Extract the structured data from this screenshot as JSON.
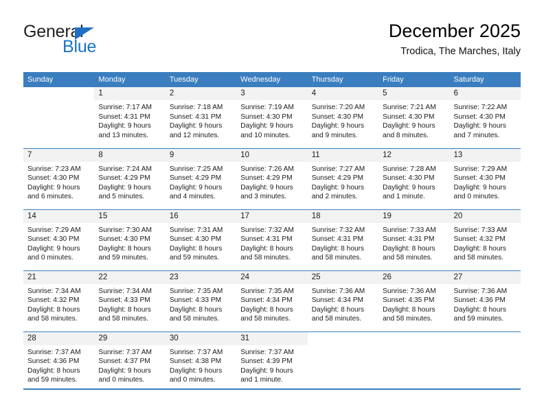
{
  "brand": {
    "word_general": "General",
    "word_blue": "Blue",
    "triangle_color": "#1f6fc4",
    "blue_text_color": "#1a73c4"
  },
  "header": {
    "title": "December 2025",
    "subtitle": "Trodica, The Marches, Italy",
    "header_bg": "#3a7ebf",
    "daynum_bg": "#f2f2f2"
  },
  "weekday_headers": [
    "Sunday",
    "Monday",
    "Tuesday",
    "Wednesday",
    "Thursday",
    "Friday",
    "Saturday"
  ],
  "weeks": [
    [
      {
        "day": "",
        "sunrise": "",
        "sunset": "",
        "daylight_line1": "",
        "daylight_line2": "",
        "blank": true
      },
      {
        "day": "1",
        "sunrise": "Sunrise: 7:17 AM",
        "sunset": "Sunset: 4:31 PM",
        "daylight_line1": "Daylight: 9 hours",
        "daylight_line2": "and 13 minutes."
      },
      {
        "day": "2",
        "sunrise": "Sunrise: 7:18 AM",
        "sunset": "Sunset: 4:31 PM",
        "daylight_line1": "Daylight: 9 hours",
        "daylight_line2": "and 12 minutes."
      },
      {
        "day": "3",
        "sunrise": "Sunrise: 7:19 AM",
        "sunset": "Sunset: 4:30 PM",
        "daylight_line1": "Daylight: 9 hours",
        "daylight_line2": "and 10 minutes."
      },
      {
        "day": "4",
        "sunrise": "Sunrise: 7:20 AM",
        "sunset": "Sunset: 4:30 PM",
        "daylight_line1": "Daylight: 9 hours",
        "daylight_line2": "and 9 minutes."
      },
      {
        "day": "5",
        "sunrise": "Sunrise: 7:21 AM",
        "sunset": "Sunset: 4:30 PM",
        "daylight_line1": "Daylight: 9 hours",
        "daylight_line2": "and 8 minutes."
      },
      {
        "day": "6",
        "sunrise": "Sunrise: 7:22 AM",
        "sunset": "Sunset: 4:30 PM",
        "daylight_line1": "Daylight: 9 hours",
        "daylight_line2": "and 7 minutes."
      }
    ],
    [
      {
        "day": "7",
        "sunrise": "Sunrise: 7:23 AM",
        "sunset": "Sunset: 4:30 PM",
        "daylight_line1": "Daylight: 9 hours",
        "daylight_line2": "and 6 minutes."
      },
      {
        "day": "8",
        "sunrise": "Sunrise: 7:24 AM",
        "sunset": "Sunset: 4:29 PM",
        "daylight_line1": "Daylight: 9 hours",
        "daylight_line2": "and 5 minutes."
      },
      {
        "day": "9",
        "sunrise": "Sunrise: 7:25 AM",
        "sunset": "Sunset: 4:29 PM",
        "daylight_line1": "Daylight: 9 hours",
        "daylight_line2": "and 4 minutes."
      },
      {
        "day": "10",
        "sunrise": "Sunrise: 7:26 AM",
        "sunset": "Sunset: 4:29 PM",
        "daylight_line1": "Daylight: 9 hours",
        "daylight_line2": "and 3 minutes."
      },
      {
        "day": "11",
        "sunrise": "Sunrise: 7:27 AM",
        "sunset": "Sunset: 4:29 PM",
        "daylight_line1": "Daylight: 9 hours",
        "daylight_line2": "and 2 minutes."
      },
      {
        "day": "12",
        "sunrise": "Sunrise: 7:28 AM",
        "sunset": "Sunset: 4:30 PM",
        "daylight_line1": "Daylight: 9 hours",
        "daylight_line2": "and 1 minute."
      },
      {
        "day": "13",
        "sunrise": "Sunrise: 7:29 AM",
        "sunset": "Sunset: 4:30 PM",
        "daylight_line1": "Daylight: 9 hours",
        "daylight_line2": "and 0 minutes."
      }
    ],
    [
      {
        "day": "14",
        "sunrise": "Sunrise: 7:29 AM",
        "sunset": "Sunset: 4:30 PM",
        "daylight_line1": "Daylight: 9 hours",
        "daylight_line2": "and 0 minutes."
      },
      {
        "day": "15",
        "sunrise": "Sunrise: 7:30 AM",
        "sunset": "Sunset: 4:30 PM",
        "daylight_line1": "Daylight: 8 hours",
        "daylight_line2": "and 59 minutes."
      },
      {
        "day": "16",
        "sunrise": "Sunrise: 7:31 AM",
        "sunset": "Sunset: 4:30 PM",
        "daylight_line1": "Daylight: 8 hours",
        "daylight_line2": "and 59 minutes."
      },
      {
        "day": "17",
        "sunrise": "Sunrise: 7:32 AM",
        "sunset": "Sunset: 4:31 PM",
        "daylight_line1": "Daylight: 8 hours",
        "daylight_line2": "and 58 minutes."
      },
      {
        "day": "18",
        "sunrise": "Sunrise: 7:32 AM",
        "sunset": "Sunset: 4:31 PM",
        "daylight_line1": "Daylight: 8 hours",
        "daylight_line2": "and 58 minutes."
      },
      {
        "day": "19",
        "sunrise": "Sunrise: 7:33 AM",
        "sunset": "Sunset: 4:31 PM",
        "daylight_line1": "Daylight: 8 hours",
        "daylight_line2": "and 58 minutes."
      },
      {
        "day": "20",
        "sunrise": "Sunrise: 7:33 AM",
        "sunset": "Sunset: 4:32 PM",
        "daylight_line1": "Daylight: 8 hours",
        "daylight_line2": "and 58 minutes."
      }
    ],
    [
      {
        "day": "21",
        "sunrise": "Sunrise: 7:34 AM",
        "sunset": "Sunset: 4:32 PM",
        "daylight_line1": "Daylight: 8 hours",
        "daylight_line2": "and 58 minutes."
      },
      {
        "day": "22",
        "sunrise": "Sunrise: 7:34 AM",
        "sunset": "Sunset: 4:33 PM",
        "daylight_line1": "Daylight: 8 hours",
        "daylight_line2": "and 58 minutes."
      },
      {
        "day": "23",
        "sunrise": "Sunrise: 7:35 AM",
        "sunset": "Sunset: 4:33 PM",
        "daylight_line1": "Daylight: 8 hours",
        "daylight_line2": "and 58 minutes."
      },
      {
        "day": "24",
        "sunrise": "Sunrise: 7:35 AM",
        "sunset": "Sunset: 4:34 PM",
        "daylight_line1": "Daylight: 8 hours",
        "daylight_line2": "and 58 minutes."
      },
      {
        "day": "25",
        "sunrise": "Sunrise: 7:36 AM",
        "sunset": "Sunset: 4:34 PM",
        "daylight_line1": "Daylight: 8 hours",
        "daylight_line2": "and 58 minutes."
      },
      {
        "day": "26",
        "sunrise": "Sunrise: 7:36 AM",
        "sunset": "Sunset: 4:35 PM",
        "daylight_line1": "Daylight: 8 hours",
        "daylight_line2": "and 58 minutes."
      },
      {
        "day": "27",
        "sunrise": "Sunrise: 7:36 AM",
        "sunset": "Sunset: 4:36 PM",
        "daylight_line1": "Daylight: 8 hours",
        "daylight_line2": "and 59 minutes."
      }
    ],
    [
      {
        "day": "28",
        "sunrise": "Sunrise: 7:37 AM",
        "sunset": "Sunset: 4:36 PM",
        "daylight_line1": "Daylight: 8 hours",
        "daylight_line2": "and 59 minutes."
      },
      {
        "day": "29",
        "sunrise": "Sunrise: 7:37 AM",
        "sunset": "Sunset: 4:37 PM",
        "daylight_line1": "Daylight: 9 hours",
        "daylight_line2": "and 0 minutes."
      },
      {
        "day": "30",
        "sunrise": "Sunrise: 7:37 AM",
        "sunset": "Sunset: 4:38 PM",
        "daylight_line1": "Daylight: 9 hours",
        "daylight_line2": "and 0 minutes."
      },
      {
        "day": "31",
        "sunrise": "Sunrise: 7:37 AM",
        "sunset": "Sunset: 4:39 PM",
        "daylight_line1": "Daylight: 9 hours",
        "daylight_line2": "and 1 minute."
      },
      {
        "day": "",
        "sunrise": "",
        "sunset": "",
        "daylight_line1": "",
        "daylight_line2": "",
        "blank": true
      },
      {
        "day": "",
        "sunrise": "",
        "sunset": "",
        "daylight_line1": "",
        "daylight_line2": "",
        "blank": true
      },
      {
        "day": "",
        "sunrise": "",
        "sunset": "",
        "daylight_line1": "",
        "daylight_line2": "",
        "blank": true
      }
    ]
  ]
}
